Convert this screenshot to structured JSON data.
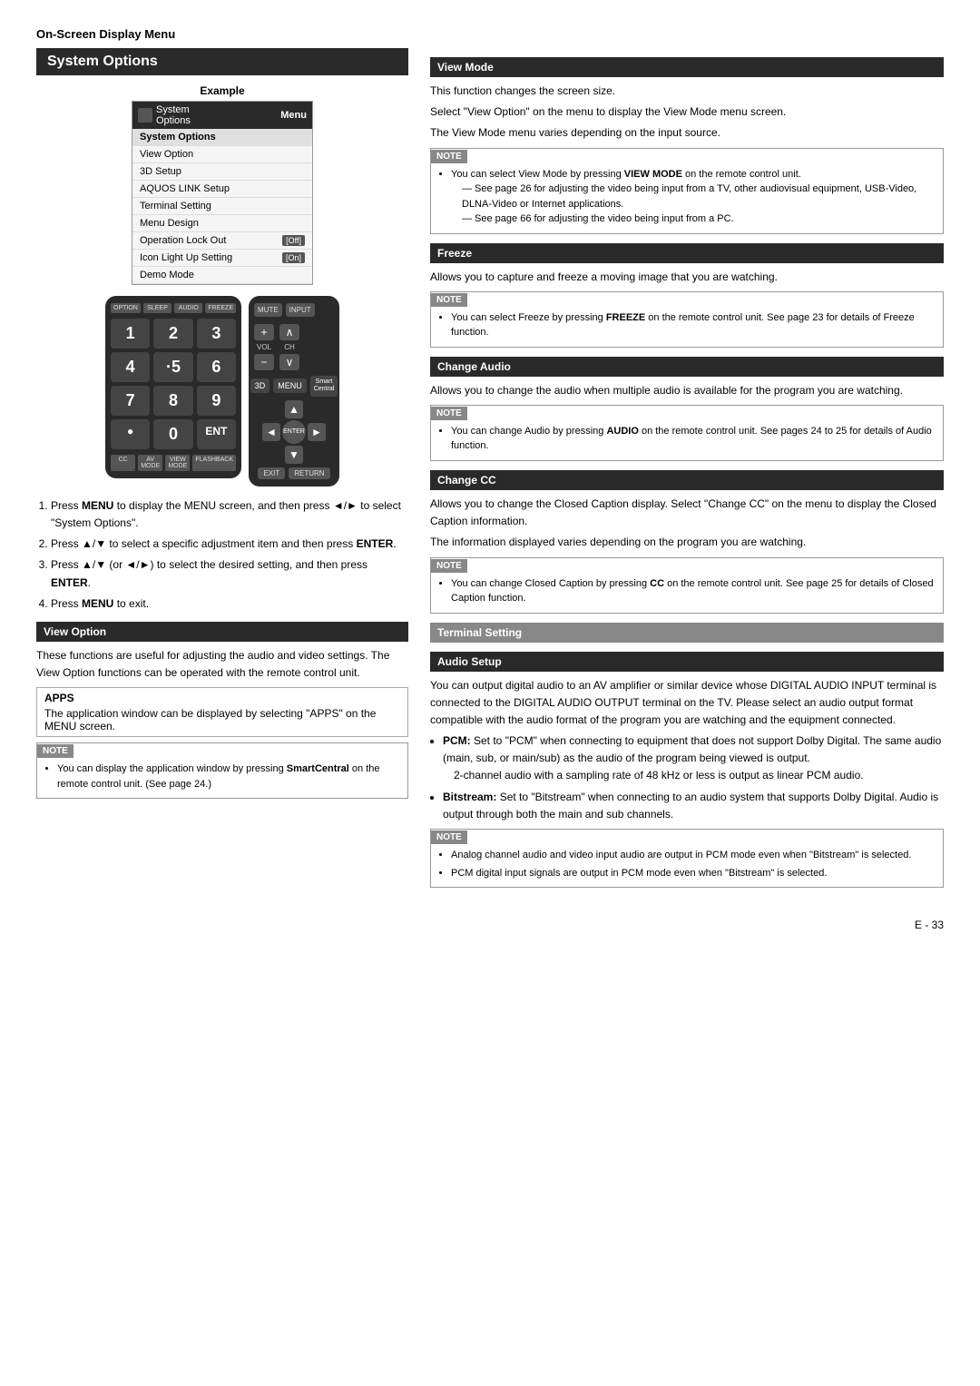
{
  "header": {
    "title": "On-Screen Display Menu"
  },
  "left": {
    "section_title": "System Options",
    "example_label": "Example",
    "menu": {
      "header_icon": "system-icon",
      "header_text": "System Options",
      "menu_label": "Menu",
      "items": [
        {
          "label": "System Options",
          "selected": true
        },
        {
          "label": "View Option",
          "selected": false
        },
        {
          "label": "3D Setup",
          "selected": false
        },
        {
          "label": "AQUOS LINK Setup",
          "selected": false
        },
        {
          "label": "Terminal Setting",
          "selected": false
        },
        {
          "label": "Menu Design",
          "selected": false
        },
        {
          "label": "Operation Lock Out",
          "badge": "[Off]",
          "selected": false
        },
        {
          "label": "Icon Light Up Setting",
          "badge": "[On]",
          "selected": false
        },
        {
          "label": "Demo Mode",
          "selected": false
        }
      ]
    },
    "remote_left": {
      "top_buttons": [
        "OPTION",
        "SLEEP",
        "AUDIO",
        "FREEZE"
      ],
      "numpad": [
        "1",
        "2",
        "3",
        "4",
        "·5",
        "6",
        "7",
        "8",
        "9",
        "●",
        "0",
        "ENT"
      ],
      "bottom_buttons": [
        "CC",
        "AV MODE",
        "VIEW MODE",
        "FLASHBACK"
      ]
    },
    "remote_right": {
      "mute": "MUTE",
      "vol_label": "VOL",
      "ch_label": "CH",
      "input_label": "INPUT",
      "three_d": "3D",
      "menu": "MENU",
      "smart_central": "Smart Central",
      "enter": "ENTER",
      "exit": "EXIT",
      "return": "RETURN"
    },
    "steps": [
      {
        "num": 1,
        "text": "Press ",
        "bold": "MENU",
        "rest": " to display the MENU screen, and then press ◄/► to select \"System Options\"."
      },
      {
        "num": 2,
        "text": "Press ▲/▼ to select a specific adjustment item and then press ",
        "bold": "ENTER",
        "rest": "."
      },
      {
        "num": 3,
        "text": "Press ▲/▼ (or ◄/►) to select the desired setting, and then press ",
        "bold": "ENTER",
        "rest": "."
      },
      {
        "num": 4,
        "text": "Press ",
        "bold": "MENU",
        "rest": " to exit."
      }
    ],
    "view_option": {
      "title": "View Option",
      "content": "These functions are useful for adjusting the audio and video settings. The View Option functions can be operated with the remote control unit.",
      "apps": {
        "title": "APPS",
        "content": "The application window can be displayed by selecting \"APPS\" on the MENU screen."
      },
      "note": {
        "items": [
          "You can display the application window by pressing SmartCentral on the remote control unit. (See page 24.)"
        ]
      }
    }
  },
  "right": {
    "view_mode": {
      "title": "View Mode",
      "content": "This function changes the screen size.",
      "lines": [
        "Select \"View Option\" on the menu to display the View Mode menu screen.",
        "The View Mode menu varies depending on the input source."
      ],
      "note": {
        "items": [
          "You can select View Mode by pressing VIEW MODE on the remote control unit.",
          "— See page 26 for adjusting the video being input from a TV, other audiovisual equipment, USB-Video, DLNA-Video or Internet applications.",
          "— See page 66 for adjusting the video being input from a PC."
        ]
      }
    },
    "freeze": {
      "title": "Freeze",
      "content": "Allows you to capture and freeze a moving image that you are watching.",
      "note": {
        "items": [
          "You can select Freeze by pressing FREEZE on the remote control unit. See page 23 for details of Freeze function."
        ]
      }
    },
    "change_audio": {
      "title": "Change Audio",
      "content": "Allows you to change the audio when multiple audio is available for the program you are watching.",
      "note": {
        "items": [
          "You can change Audio by pressing AUDIO on the remote control unit. See pages 24 to 25 for details of Audio function."
        ]
      }
    },
    "change_cc": {
      "title": "Change CC",
      "content": "Allows you to change the Closed Caption display. Select \"Change CC\" on the menu to display the Closed Caption information.",
      "extra": "The information displayed varies depending on the program you are watching.",
      "note": {
        "items": [
          "You can change Closed Caption by pressing CC on the remote control unit. See page 25 for details of Closed Caption function."
        ]
      }
    },
    "terminal_setting": {
      "title": "Terminal Setting",
      "audio_setup": {
        "title": "Audio Setup",
        "content": "You can output digital audio to an AV amplifier or similar device whose DIGITAL AUDIO INPUT terminal is connected to the DIGITAL AUDIO OUTPUT terminal on the TV. Please select an audio output format compatible with the audio format of the program you are watching and the equipment connected.",
        "pcm": "PCM: Set to \"PCM\" when connecting to equipment that does not support Dolby Digital. The same audio (main, sub, or main/sub) as the audio of the program being viewed is output.",
        "pcm_note": "2-channel audio with a sampling rate of 48 kHz or less is output as linear PCM audio.",
        "bitstream": "Bitstream: Set to \"Bitstream\" when connecting to an audio system that supports Dolby Digital. Audio is output through both the main and sub channels.",
        "note": {
          "items": [
            "Analog channel audio and video input audio are output in PCM mode even when \"Bitstream\" is selected.",
            "PCM digital input signals are output in PCM mode even when \"Bitstream\" is selected."
          ]
        }
      }
    }
  },
  "footer": {
    "page": "E - 33"
  }
}
